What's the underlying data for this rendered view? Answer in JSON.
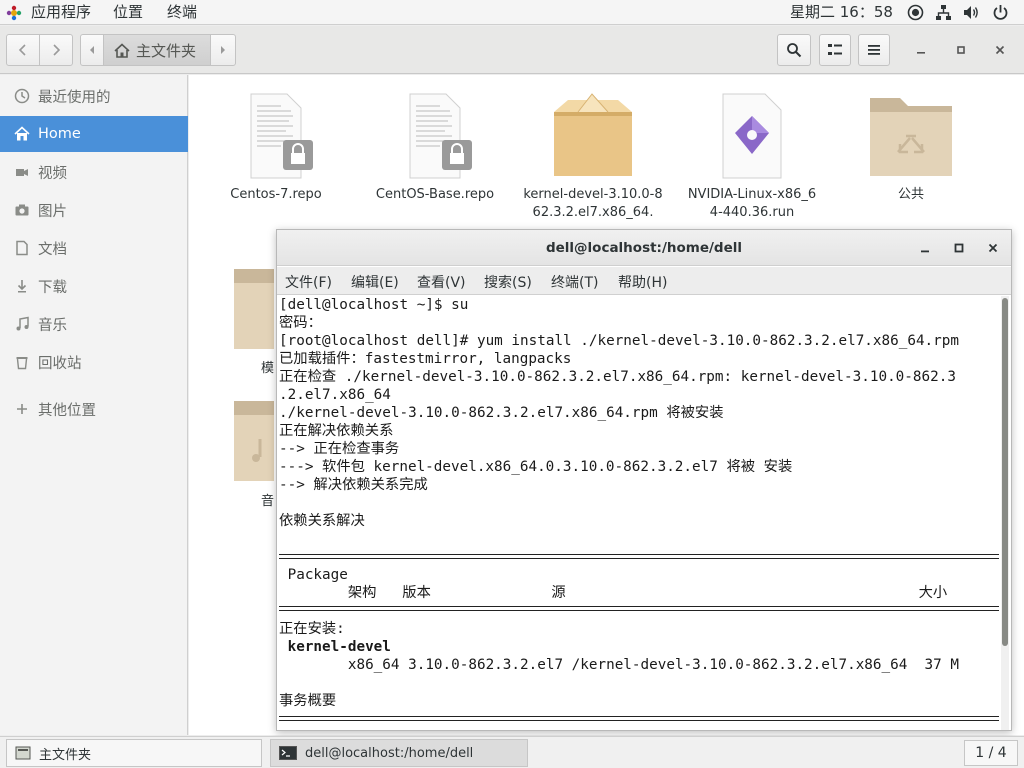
{
  "top_panel": {
    "apps_label": "应用程序",
    "places_label": "位置",
    "terminal_label": "终端",
    "clock": "星期二 16：58"
  },
  "file_manager": {
    "path_home_label": "主文件夹",
    "sidebar": {
      "items": [
        {
          "label": "最近使用的",
          "icon": "clock-icon"
        },
        {
          "label": "Home",
          "icon": "home-icon"
        },
        {
          "label": "视频",
          "icon": "video-icon"
        },
        {
          "label": "图片",
          "icon": "camera-icon"
        },
        {
          "label": "文档",
          "icon": "document-icon"
        },
        {
          "label": "下载",
          "icon": "download-icon"
        },
        {
          "label": "音乐",
          "icon": "music-icon"
        },
        {
          "label": "回收站",
          "icon": "trash-icon"
        },
        {
          "label": "其他位置",
          "icon": "plus-icon"
        }
      ]
    },
    "files": [
      {
        "name": "Centos-7.repo"
      },
      {
        "name": "CentOS-Base.repo"
      },
      {
        "name": "kernel-devel-3.10.0-862.3.2.el7.x86_64."
      },
      {
        "name": "NVIDIA-Linux-x86_64-440.36.run"
      },
      {
        "name": "公共"
      },
      {
        "name": "模"
      },
      {
        "name": "音"
      }
    ]
  },
  "terminal": {
    "title": "dell@localhost:/home/dell",
    "menus": [
      "文件(F)",
      "编辑(E)",
      "查看(V)",
      "搜索(S)",
      "终端(T)",
      "帮助(H)"
    ],
    "lines": [
      "[dell@localhost ~]$ su",
      "密码：",
      "[root@localhost dell]# yum install ./kernel-devel-3.10.0-862.3.2.el7.x86_64.rpm",
      "已加载插件：fastestmirror, langpacks",
      "正在检查 ./kernel-devel-3.10.0-862.3.2.el7.x86_64.rpm: kernel-devel-3.10.0-862.3",
      ".2.el7.x86_64",
      "./kernel-devel-3.10.0-862.3.2.el7.x86_64.rpm 将被安装",
      "正在解决依赖关系",
      "--> 正在检查事务",
      "---> 软件包 kernel-devel.x86_64.0.3.10.0-862.3.2.el7 将被 安装",
      "--> 解决依赖关系完成",
      "",
      "依赖关系解决",
      ""
    ],
    "table": {
      "package_header": " Package",
      "columns_header": "        架构   版本              源                                         大小",
      "installing_label": "正在安装:",
      "package_name": " kernel-devel",
      "package_row": "        x86_64 3.10.0-862.3.2.el7 /kernel-devel-3.10.0-862.3.2.el7.x86_64  37 M",
      "summary_label": "事务概要"
    }
  },
  "bottom_panel": {
    "task_files": "主文件夹",
    "task_terminal": "dell@localhost:/home/dell",
    "workspace": "1 / 4"
  },
  "colors": {
    "accent": "#4a90d9",
    "panel_bg": "#f5f5f5"
  }
}
